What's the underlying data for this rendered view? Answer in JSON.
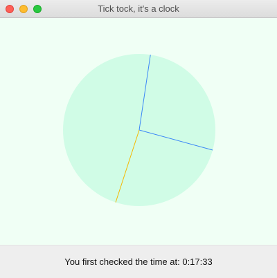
{
  "window": {
    "title": "Tick tock, it's a clock"
  },
  "clock": {
    "face_color": "#d0fce6",
    "hour_hand_color": "#3a86f7",
    "minute_hand_color": "#3a86f7",
    "second_hand_color": "#f5b800",
    "time_shown": {
      "hour": 0,
      "minute": 17,
      "second": 33
    }
  },
  "status": {
    "message": "You first checked the time at: 0:17:33"
  }
}
